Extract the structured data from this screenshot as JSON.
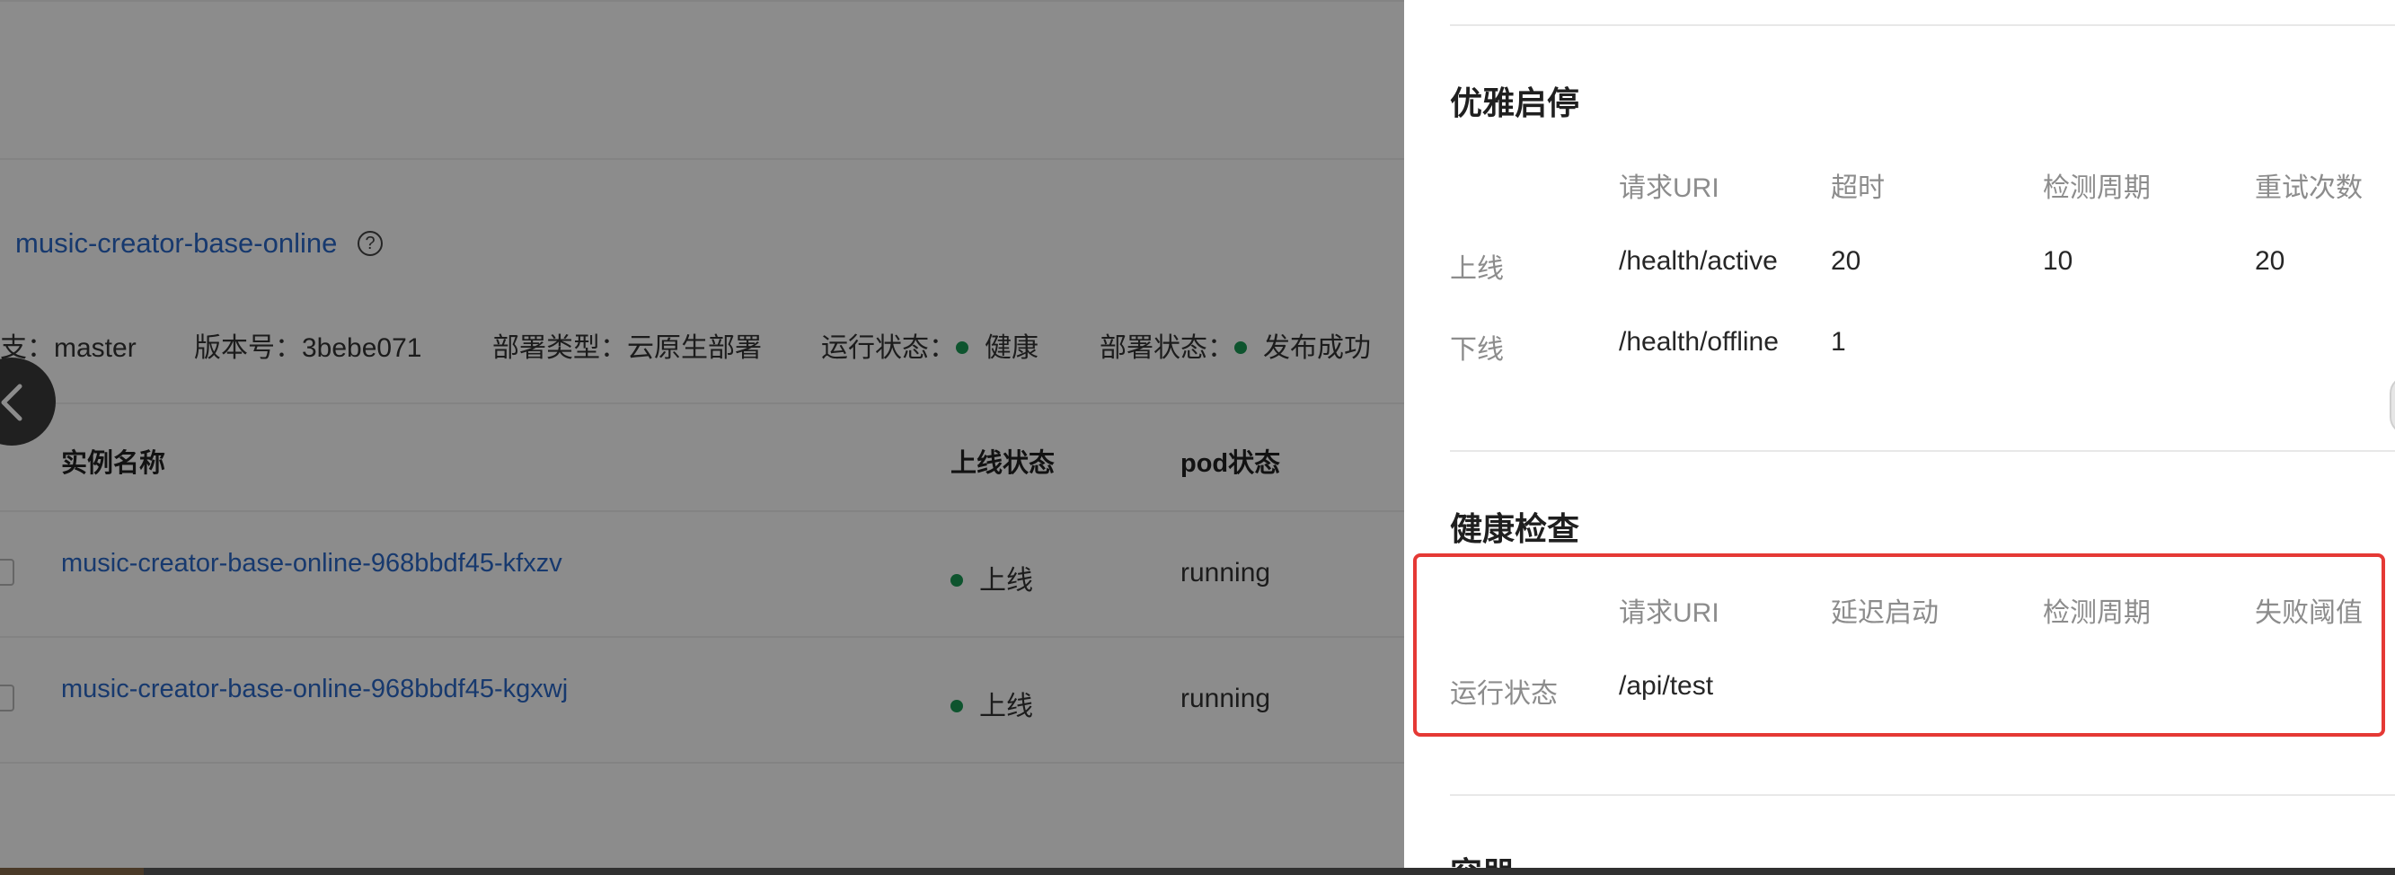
{
  "background": {
    "app_name": "music-creator-base-online",
    "help_icon": "question-circle-icon",
    "info": {
      "branch": "支：master",
      "version": "版本号：3bebe071",
      "deploy_type": "部署类型：云原生部署",
      "run_status_label": "运行状态：",
      "run_status_value": "健康",
      "deploy_status_label": "部署状态：",
      "deploy_status_value": "发布成功"
    },
    "table": {
      "headers": {
        "name": "实例名称",
        "online": "上线状态",
        "pod": "pod状态"
      },
      "rows": [
        {
          "name": "music-creator-base-online-968bbdf45-kfxzv",
          "online": "上线",
          "pod": "running"
        },
        {
          "name": "music-creator-base-online-968bbdf45-kgxwj",
          "online": "上线",
          "pod": "running"
        }
      ]
    },
    "prev_icon": "chevron-left-icon",
    "status_color": "#1a9a55",
    "link_color": "#2a69c9"
  },
  "drawer": {
    "graceful": {
      "title": "优雅启停",
      "headers": [
        "请求URI",
        "超时",
        "检测周期",
        "重试次数"
      ],
      "rows": [
        {
          "label": "上线",
          "values": [
            "/health/active",
            "20",
            "10",
            "20"
          ]
        },
        {
          "label": "下线",
          "values": [
            "/health/offline",
            "1",
            "",
            ""
          ]
        }
      ]
    },
    "health": {
      "title": "健康检查",
      "headers": [
        "请求URI",
        "延迟启动",
        "检测周期",
        "失败阈值"
      ],
      "rows": [
        {
          "label": "运行状态",
          "values": [
            "/api/test",
            "",
            "",
            ""
          ]
        }
      ],
      "highlight_color": "#e53935"
    },
    "container": {
      "title": "容器"
    }
  }
}
